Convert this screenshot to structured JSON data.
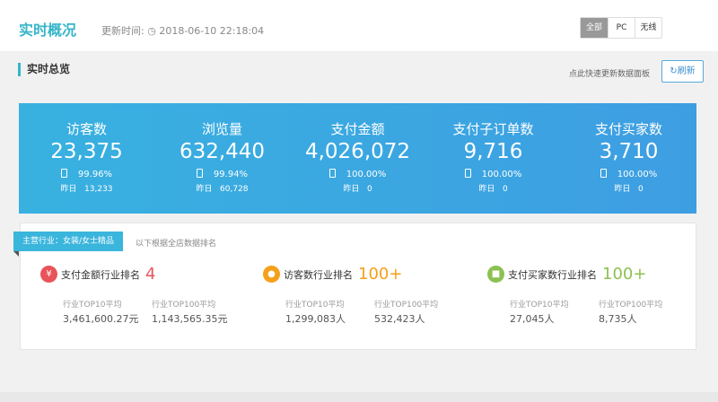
{
  "header": {
    "title": "实时概况",
    "update_label": "更新时间:",
    "update_time": "2018-06-10 22:18:04",
    "segments": [
      "全部",
      "PC",
      "无线"
    ]
  },
  "section": {
    "title": "实时总览",
    "hint": "点此快速更新数据面板",
    "refresh": "刷新"
  },
  "stats": [
    {
      "label": "访客数",
      "value": "23,375",
      "pct": "99.96%",
      "y_label": "昨日",
      "y_value": "13,233"
    },
    {
      "label": "浏览量",
      "value": "632,440",
      "pct": "99.94%",
      "y_label": "昨日",
      "y_value": "60,728"
    },
    {
      "label": "支付金额",
      "value": "4,026,072",
      "pct": "100.00%",
      "y_label": "昨日",
      "y_value": "0"
    },
    {
      "label": "支付子订单数",
      "value": "9,716",
      "pct": "100.00%",
      "y_label": "昨日",
      "y_value": "0"
    },
    {
      "label": "支付买家数",
      "value": "3,710",
      "pct": "100.00%",
      "y_label": "昨日",
      "y_value": "0"
    }
  ],
  "industry": {
    "tag": "主营行业：女装/女士精品",
    "sub": "以下根据全店数据排名",
    "ranks": [
      {
        "icon": "¥",
        "label": "支付金额行业排名",
        "value": "4",
        "color": "#e8545a",
        "top10_label": "行业TOP10平均",
        "top10": "3,461,600.27元",
        "top100_label": "行业TOP100平均",
        "top100": "1,143,565.35元"
      },
      {
        "icon": "●",
        "label": "访客数行业排名",
        "value": "100+",
        "color": "#f5a01a",
        "top10_label": "行业TOP10平均",
        "top10": "1,299,083人",
        "top100_label": "行业TOP100平均",
        "top100": "532,423人"
      },
      {
        "icon": "■",
        "label": "支付买家数行业排名",
        "value": "100+",
        "color": "#8cc152",
        "top10_label": "行业TOP10平均",
        "top10": "27,045人",
        "top100_label": "行业TOP100平均",
        "top100": "8,735人"
      }
    ]
  }
}
